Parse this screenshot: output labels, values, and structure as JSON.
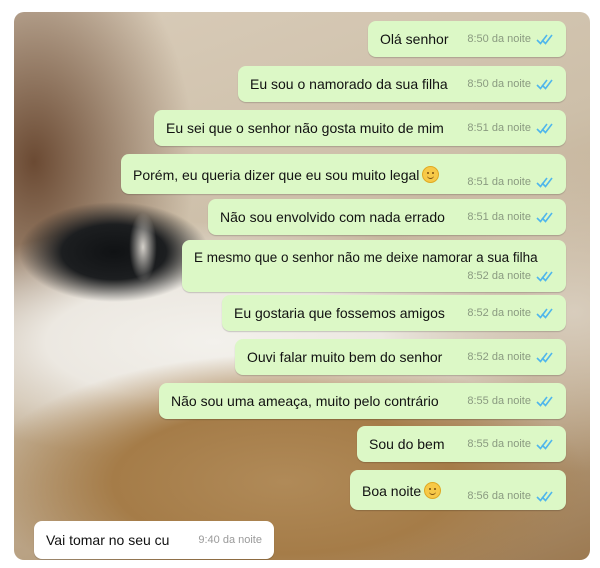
{
  "messages": [
    {
      "text": "Olá senhor",
      "time": "8:50 da noite"
    },
    {
      "text": "Eu sou o namorado da sua filha",
      "time": "8:50 da noite"
    },
    {
      "text": "Eu sei que o senhor não gosta muito de mim",
      "time": "8:51 da noite"
    },
    {
      "text": "Porém, eu queria dizer que eu sou muito legal",
      "time": "8:51 da noite",
      "emoji": "smiling-face-emoji"
    },
    {
      "text": "Não sou envolvido com nada errado",
      "time": "8:51 da noite"
    },
    {
      "text": "E mesmo que o senhor não me deixe namorar a sua filha",
      "time": "8:52 da noite"
    },
    {
      "text": "Eu gostaria que fossemos amigos",
      "time": "8:52 da noite"
    },
    {
      "text": "Ouvi falar muito bem do senhor",
      "time": "8:52 da noite"
    },
    {
      "text": "Não sou uma ameaça, muito pelo contrário",
      "time": "8:55 da noite"
    },
    {
      "text": "Sou do bem",
      "time": "8:55 da noite"
    },
    {
      "text": "Boa noite",
      "time": "8:56 da noite",
      "emoji": "smiling-face-emoji"
    }
  ],
  "reply": {
    "text": "Vai tomar no seu cu",
    "time": "9:40 da noite"
  },
  "colors": {
    "outgoing_bubble": "#dcf8c6",
    "incoming_bubble": "#ffffff",
    "read_ticks": "#4fb6ec"
  },
  "icons": {
    "read_receipt": "double-check-icon"
  }
}
